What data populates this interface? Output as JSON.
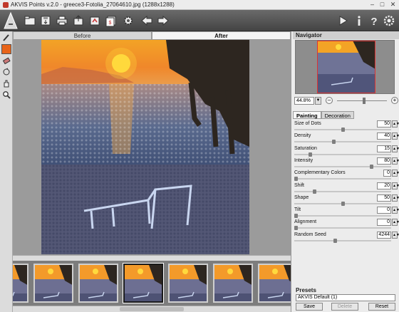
{
  "window": {
    "title": "AKVIS Points v.2.0 - greece3-Fotolia_27064610.jpg (1288x1288)",
    "minimize": "–",
    "maximize": "□",
    "close": "✕"
  },
  "toolbar": {
    "left_icons": [
      "open-icon",
      "save-icon",
      "print-icon",
      "share-icon",
      "export-icon",
      "batch-icon",
      "settings-gear-icon",
      "back-arrow-icon",
      "forward-arrow-icon"
    ],
    "right_icons": [
      "run-icon",
      "info-icon",
      "help-icon",
      "preferences-icon"
    ]
  },
  "left_tools": [
    "brush-icon",
    "color-swatch",
    "eraser-icon",
    "restore-icon",
    "hand-icon",
    "zoom-icon"
  ],
  "colors": {
    "accent": "#e8731a",
    "swatch": "#e8641a",
    "toolbar": "#555555",
    "sun": "#ffd93d"
  },
  "canvas_tabs": [
    {
      "label": "Before",
      "active": false
    },
    {
      "label": "After",
      "active": true
    }
  ],
  "navigator": {
    "title": "Navigator",
    "zoom": "44.8%",
    "zoom_out": "–",
    "zoom_in": "+",
    "zoom_level": 0.55
  },
  "settings_tabs": [
    {
      "label": "Painting",
      "active": true
    },
    {
      "label": "Decoration",
      "active": false
    }
  ],
  "params": [
    {
      "label": "Size of Dots",
      "value": "50",
      "level": 0.5
    },
    {
      "label": "Density",
      "value": "40",
      "level": 0.4
    },
    {
      "label": "Saturation",
      "value": "15",
      "level": 0.15
    },
    {
      "label": "Intensity",
      "value": "80",
      "level": 0.8
    },
    {
      "label": "Complementary Colors",
      "value": "0",
      "level": 0
    },
    {
      "label": "Shift",
      "value": "20",
      "level": 0.2
    },
    {
      "label": "Shape",
      "value": "50",
      "level": 0.5
    },
    {
      "label": "Tilt",
      "value": "0",
      "level": 0
    },
    {
      "label": "Alignment",
      "value": "0",
      "level": 0
    },
    {
      "label": "Random Seed",
      "value": "4244",
      "level": 0.42
    }
  ],
  "presets": {
    "title": "Presets",
    "selected": "AKVIS Default (1)",
    "save": "Save",
    "delete": "Delete",
    "reset": "Reset"
  },
  "filmstrip": {
    "count": 7,
    "selected_index": 3
  }
}
